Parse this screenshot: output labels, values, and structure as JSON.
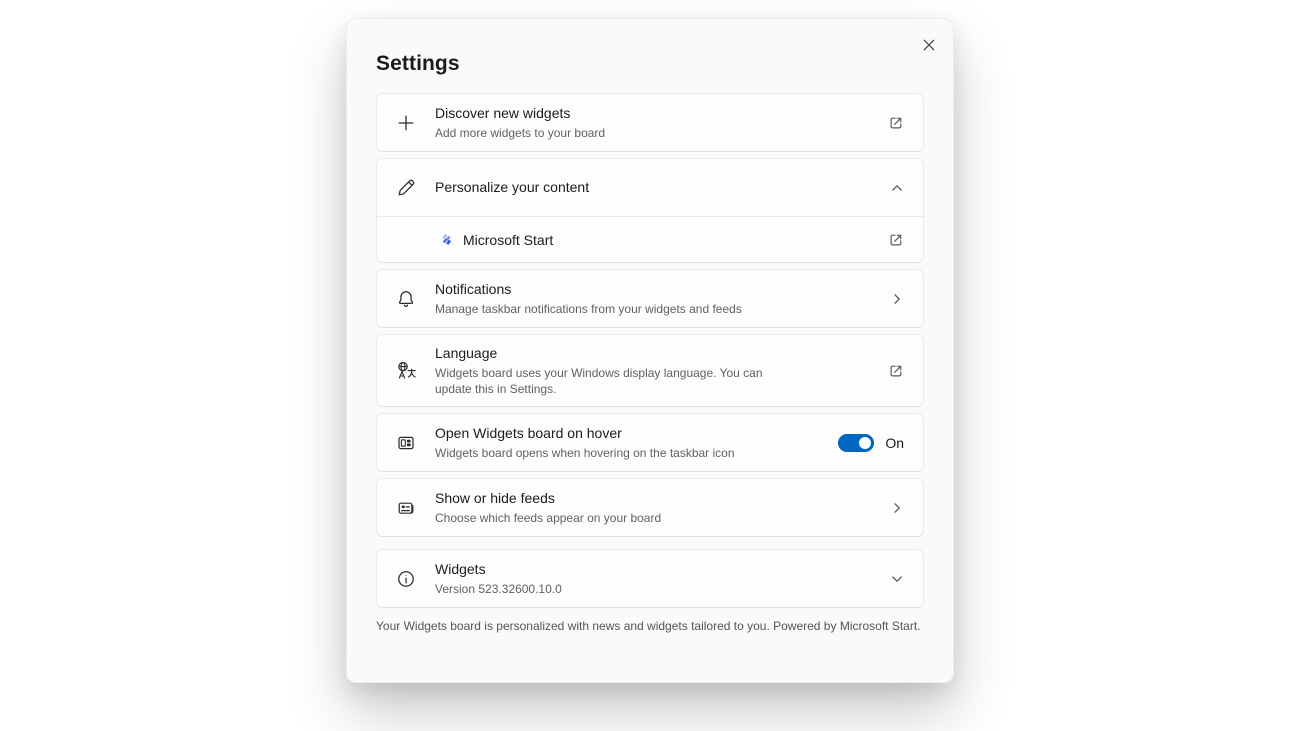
{
  "dialog": {
    "title": "Settings",
    "close_icon": "close-icon",
    "footer": "Your Widgets board is personalized with news and widgets tailored to you. Powered by Microsoft Start."
  },
  "colors": {
    "accent_toggle_on": "#0067c0",
    "dialog_bg": "#fafafa",
    "card_bg": "#fdfdfd",
    "title_text": "#1b1b1b",
    "secondary_text": "#616161"
  },
  "cards": {
    "discover": {
      "icon": "plus-icon",
      "title": "Discover new widgets",
      "description": "Add more widgets to your board",
      "action_icon": "external-link-icon"
    },
    "personalize": {
      "icon": "pencil-icon",
      "title": "Personalize your content",
      "action_icon": "chevron-up-icon",
      "expanded": true,
      "sub_item": {
        "icon": "microsoft-start-logo",
        "label": "Microsoft Start",
        "action_icon": "external-link-icon"
      }
    },
    "notifications": {
      "icon": "bell-icon",
      "title": "Notifications",
      "description": "Manage taskbar notifications from your widgets and feeds",
      "action_icon": "chevron-right-icon"
    },
    "language": {
      "icon": "translate-icon",
      "title": "Language",
      "description": "Widgets board uses your Windows display language. You can update this in Settings.",
      "action_icon": "external-link-icon"
    },
    "hover": {
      "icon": "widgets-board-icon",
      "title": "Open Widgets board on hover",
      "description": "Widgets board opens when hovering on the taskbar icon",
      "toggle": {
        "on": true,
        "state_label": "On"
      }
    },
    "feeds": {
      "icon": "feeds-icon",
      "title": "Show or hide feeds",
      "description": "Choose which feeds appear on your board",
      "action_icon": "chevron-right-icon"
    },
    "about": {
      "icon": "info-icon",
      "title": "Widgets",
      "description": "Version 523.32600.10.0",
      "action_icon": "chevron-down-icon"
    }
  }
}
